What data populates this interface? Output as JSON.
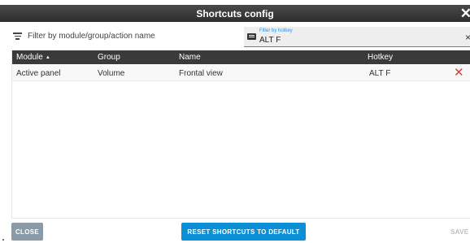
{
  "dialog": {
    "title": "Shortcuts config",
    "close_glyph": "✕"
  },
  "filters": {
    "name_filter_placeholder": "Filter by module/group/action name",
    "name_filter_icon": "filter-list-icon",
    "hotkey_label": "Filter by hotkey",
    "hotkey_value": "ALT F",
    "hotkey_icon": "keyboard-icon",
    "hotkey_clear_glyph": "×"
  },
  "table": {
    "columns": [
      {
        "label": "Module",
        "sort": "ascending"
      },
      {
        "label": "Group"
      },
      {
        "label": "Name"
      },
      {
        "label": "Hotkey"
      }
    ],
    "sort_glyph": "▲",
    "rows": [
      {
        "module": "Active panel",
        "group": "Volume",
        "name": "Frontal view",
        "hotkey": "ALT F",
        "delete_glyph": "✕"
      }
    ]
  },
  "footer": {
    "close_label": "CLOSE",
    "reset_label": "RESET SHORTCUTS TO DEFAULT",
    "save_label": "SAVE"
  },
  "colors": {
    "header_bg": "#3a3a3a",
    "accent": "#2196f3",
    "primary_button": "#0d8fd6",
    "delete": "#e53935"
  }
}
